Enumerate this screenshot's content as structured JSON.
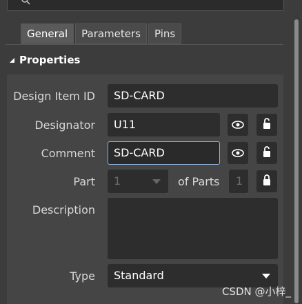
{
  "tabs": [
    {
      "label": "General",
      "active": true
    },
    {
      "label": "Parameters",
      "active": false
    },
    {
      "label": "Pins",
      "active": false
    }
  ],
  "section": {
    "title": "Properties"
  },
  "fields": {
    "design_item_id": {
      "label": "Design Item ID",
      "value": "SD-CARD"
    },
    "designator": {
      "label": "Designator",
      "value": "U11"
    },
    "comment": {
      "label": "Comment",
      "value": "SD-CARD"
    },
    "part": {
      "label": "Part",
      "value": "1",
      "of_label": "of Parts",
      "of_value": "1"
    },
    "description": {
      "label": "Description",
      "value": ""
    },
    "type": {
      "label": "Type",
      "value": "Standard"
    }
  },
  "icons": {
    "search": "search-icon",
    "visibility": "eye-icon",
    "lock": "unlock-icon",
    "lock_closed": "lock-icon"
  },
  "colors": {
    "accent_focus": "#8fb2d8"
  },
  "watermark": "CSDN @小梓_"
}
